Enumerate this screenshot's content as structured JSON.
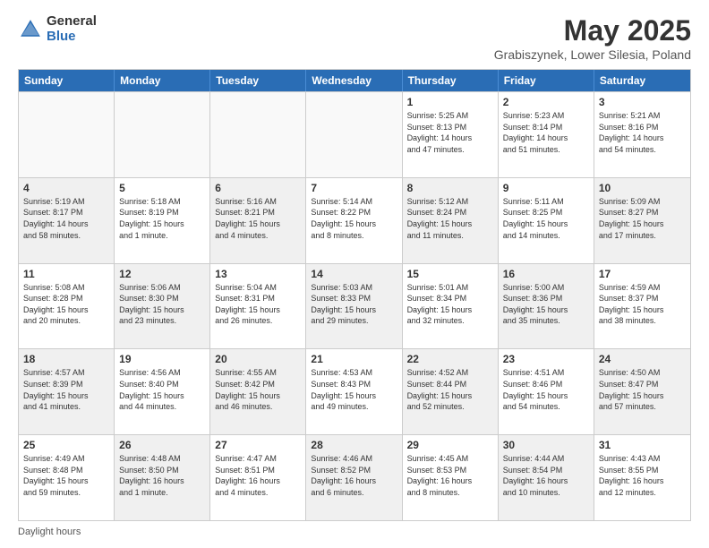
{
  "logo": {
    "general": "General",
    "blue": "Blue"
  },
  "title": "May 2025",
  "subtitle": "Grabiszynek, Lower Silesia, Poland",
  "days_of_week": [
    "Sunday",
    "Monday",
    "Tuesday",
    "Wednesday",
    "Thursday",
    "Friday",
    "Saturday"
  ],
  "footer": "Daylight hours",
  "weeks": [
    [
      {
        "day": "",
        "text": "",
        "empty": true
      },
      {
        "day": "",
        "text": "",
        "empty": true
      },
      {
        "day": "",
        "text": "",
        "empty": true
      },
      {
        "day": "",
        "text": "",
        "empty": true
      },
      {
        "day": "1",
        "text": "Sunrise: 5:25 AM\nSunset: 8:13 PM\nDaylight: 14 hours\nand 47 minutes.",
        "empty": false
      },
      {
        "day": "2",
        "text": "Sunrise: 5:23 AM\nSunset: 8:14 PM\nDaylight: 14 hours\nand 51 minutes.",
        "empty": false
      },
      {
        "day": "3",
        "text": "Sunrise: 5:21 AM\nSunset: 8:16 PM\nDaylight: 14 hours\nand 54 minutes.",
        "empty": false
      }
    ],
    [
      {
        "day": "4",
        "text": "Sunrise: 5:19 AM\nSunset: 8:17 PM\nDaylight: 14 hours\nand 58 minutes.",
        "shaded": true
      },
      {
        "day": "5",
        "text": "Sunrise: 5:18 AM\nSunset: 8:19 PM\nDaylight: 15 hours\nand 1 minute.",
        "shaded": false
      },
      {
        "day": "6",
        "text": "Sunrise: 5:16 AM\nSunset: 8:21 PM\nDaylight: 15 hours\nand 4 minutes.",
        "shaded": true
      },
      {
        "day": "7",
        "text": "Sunrise: 5:14 AM\nSunset: 8:22 PM\nDaylight: 15 hours\nand 8 minutes.",
        "shaded": false
      },
      {
        "day": "8",
        "text": "Sunrise: 5:12 AM\nSunset: 8:24 PM\nDaylight: 15 hours\nand 11 minutes.",
        "shaded": true
      },
      {
        "day": "9",
        "text": "Sunrise: 5:11 AM\nSunset: 8:25 PM\nDaylight: 15 hours\nand 14 minutes.",
        "shaded": false
      },
      {
        "day": "10",
        "text": "Sunrise: 5:09 AM\nSunset: 8:27 PM\nDaylight: 15 hours\nand 17 minutes.",
        "shaded": true
      }
    ],
    [
      {
        "day": "11",
        "text": "Sunrise: 5:08 AM\nSunset: 8:28 PM\nDaylight: 15 hours\nand 20 minutes.",
        "shaded": false
      },
      {
        "day": "12",
        "text": "Sunrise: 5:06 AM\nSunset: 8:30 PM\nDaylight: 15 hours\nand 23 minutes.",
        "shaded": true
      },
      {
        "day": "13",
        "text": "Sunrise: 5:04 AM\nSunset: 8:31 PM\nDaylight: 15 hours\nand 26 minutes.",
        "shaded": false
      },
      {
        "day": "14",
        "text": "Sunrise: 5:03 AM\nSunset: 8:33 PM\nDaylight: 15 hours\nand 29 minutes.",
        "shaded": true
      },
      {
        "day": "15",
        "text": "Sunrise: 5:01 AM\nSunset: 8:34 PM\nDaylight: 15 hours\nand 32 minutes.",
        "shaded": false
      },
      {
        "day": "16",
        "text": "Sunrise: 5:00 AM\nSunset: 8:36 PM\nDaylight: 15 hours\nand 35 minutes.",
        "shaded": true
      },
      {
        "day": "17",
        "text": "Sunrise: 4:59 AM\nSunset: 8:37 PM\nDaylight: 15 hours\nand 38 minutes.",
        "shaded": false
      }
    ],
    [
      {
        "day": "18",
        "text": "Sunrise: 4:57 AM\nSunset: 8:39 PM\nDaylight: 15 hours\nand 41 minutes.",
        "shaded": true
      },
      {
        "day": "19",
        "text": "Sunrise: 4:56 AM\nSunset: 8:40 PM\nDaylight: 15 hours\nand 44 minutes.",
        "shaded": false
      },
      {
        "day": "20",
        "text": "Sunrise: 4:55 AM\nSunset: 8:42 PM\nDaylight: 15 hours\nand 46 minutes.",
        "shaded": true
      },
      {
        "day": "21",
        "text": "Sunrise: 4:53 AM\nSunset: 8:43 PM\nDaylight: 15 hours\nand 49 minutes.",
        "shaded": false
      },
      {
        "day": "22",
        "text": "Sunrise: 4:52 AM\nSunset: 8:44 PM\nDaylight: 15 hours\nand 52 minutes.",
        "shaded": true
      },
      {
        "day": "23",
        "text": "Sunrise: 4:51 AM\nSunset: 8:46 PM\nDaylight: 15 hours\nand 54 minutes.",
        "shaded": false
      },
      {
        "day": "24",
        "text": "Sunrise: 4:50 AM\nSunset: 8:47 PM\nDaylight: 15 hours\nand 57 minutes.",
        "shaded": true
      }
    ],
    [
      {
        "day": "25",
        "text": "Sunrise: 4:49 AM\nSunset: 8:48 PM\nDaylight: 15 hours\nand 59 minutes.",
        "shaded": false
      },
      {
        "day": "26",
        "text": "Sunrise: 4:48 AM\nSunset: 8:50 PM\nDaylight: 16 hours\nand 1 minute.",
        "shaded": true
      },
      {
        "day": "27",
        "text": "Sunrise: 4:47 AM\nSunset: 8:51 PM\nDaylight: 16 hours\nand 4 minutes.",
        "shaded": false
      },
      {
        "day": "28",
        "text": "Sunrise: 4:46 AM\nSunset: 8:52 PM\nDaylight: 16 hours\nand 6 minutes.",
        "shaded": true
      },
      {
        "day": "29",
        "text": "Sunrise: 4:45 AM\nSunset: 8:53 PM\nDaylight: 16 hours\nand 8 minutes.",
        "shaded": false
      },
      {
        "day": "30",
        "text": "Sunrise: 4:44 AM\nSunset: 8:54 PM\nDaylight: 16 hours\nand 10 minutes.",
        "shaded": true
      },
      {
        "day": "31",
        "text": "Sunrise: 4:43 AM\nSunset: 8:55 PM\nDaylight: 16 hours\nand 12 minutes.",
        "shaded": false
      }
    ]
  ]
}
